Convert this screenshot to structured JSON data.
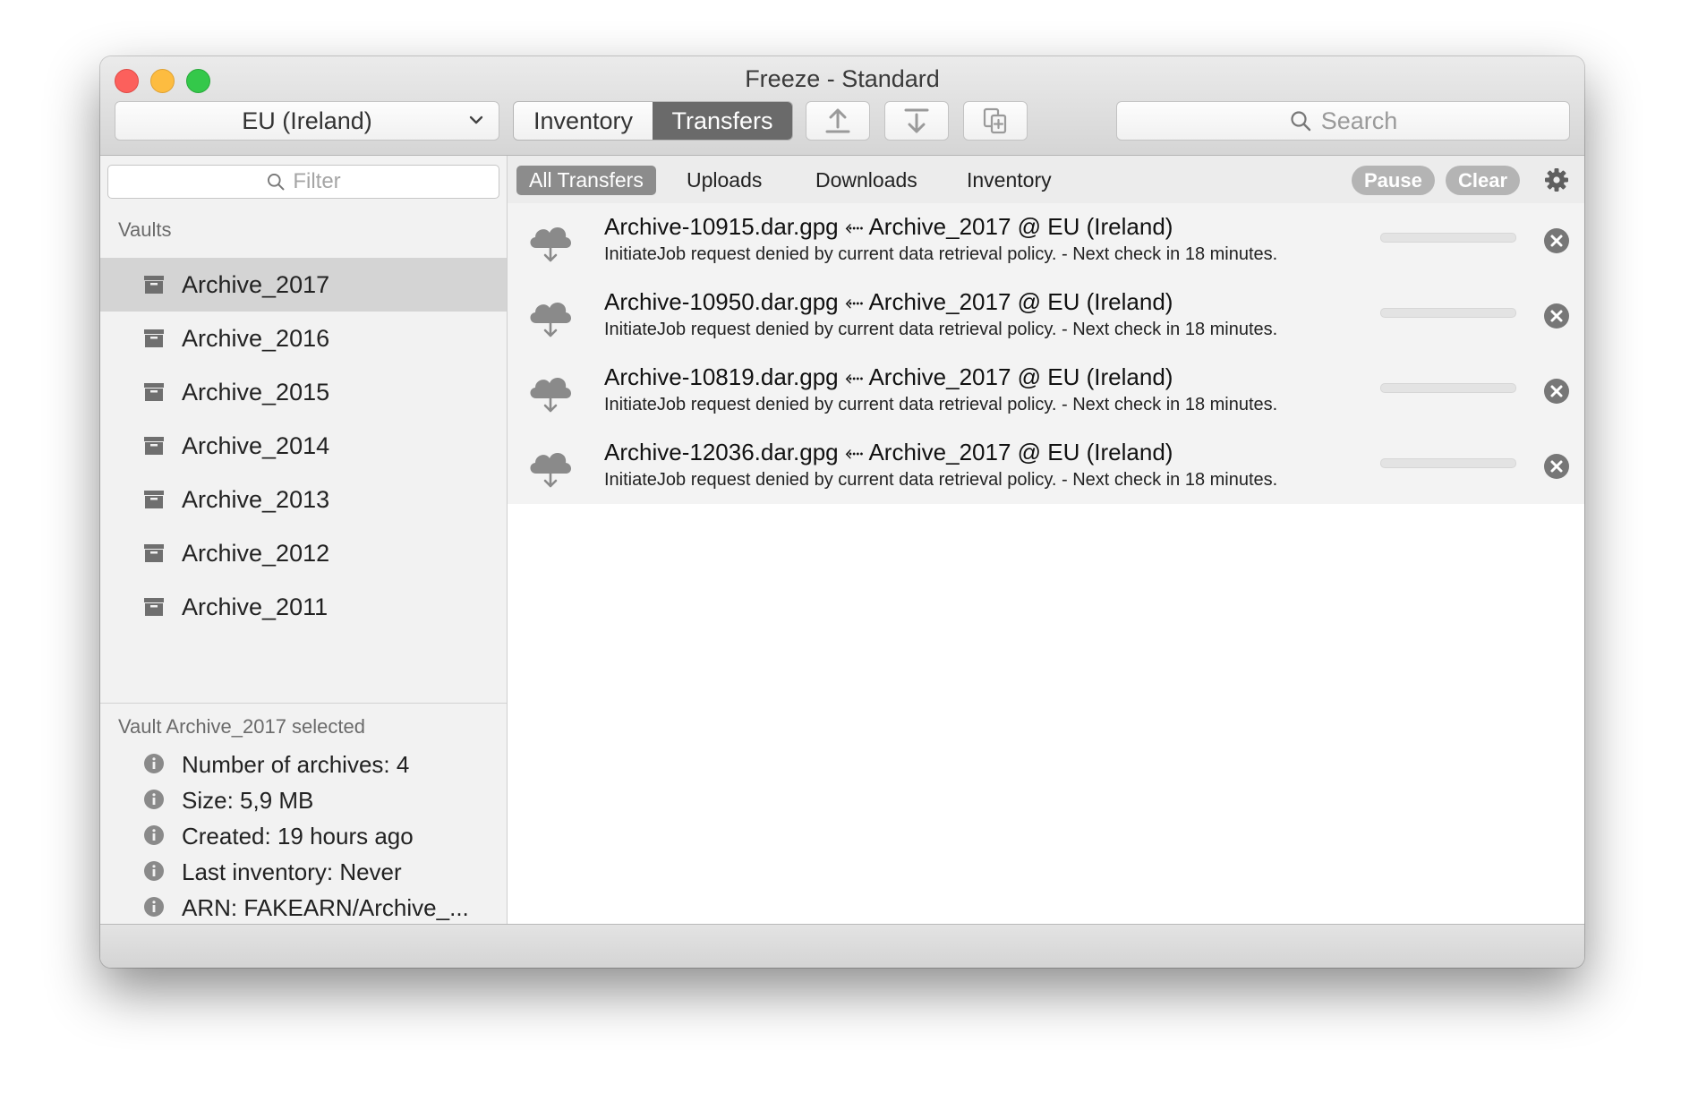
{
  "window": {
    "title": "Freeze - Standard"
  },
  "toolbar": {
    "region": "EU (Ireland)",
    "tab_inventory": "Inventory",
    "tab_transfers": "Transfers",
    "search_placeholder": "Search"
  },
  "sidebar": {
    "filter_placeholder": "Filter",
    "vaults_header": "Vaults",
    "vaults": [
      {
        "label": "Archive_2017"
      },
      {
        "label": "Archive_2016"
      },
      {
        "label": "Archive_2015"
      },
      {
        "label": "Archive_2014"
      },
      {
        "label": "Archive_2013"
      },
      {
        "label": "Archive_2012"
      },
      {
        "label": "Archive_2011"
      }
    ],
    "selected_header": "Vault Archive_2017 selected",
    "info": [
      {
        "label": "Number of archives: 4"
      },
      {
        "label": "Size: 5,9 MB"
      },
      {
        "label": "Created: 19 hours ago"
      },
      {
        "label": "Last inventory: Never"
      },
      {
        "label": "ARN: FAKEARN/Archive_..."
      }
    ]
  },
  "filterbar": {
    "tabs": [
      {
        "label": "All Transfers"
      },
      {
        "label": "Uploads"
      },
      {
        "label": "Downloads"
      },
      {
        "label": "Inventory"
      }
    ],
    "pause_label": "Pause",
    "clear_label": "Clear"
  },
  "transfers": [
    {
      "title": "Archive-10915.dar.gpg ⬸ Archive_2017 @ EU (Ireland)",
      "status": "InitiateJob request denied by current data retrieval policy. - Next check in 18 minutes.",
      "progress": 0
    },
    {
      "title": "Archive-10950.dar.gpg ⬸ Archive_2017 @ EU (Ireland)",
      "status": "InitiateJob request denied by current data retrieval policy. - Next check in 18 minutes.",
      "progress": 0
    },
    {
      "title": "Archive-10819.dar.gpg ⬸ Archive_2017 @ EU (Ireland)",
      "status": "InitiateJob request denied by current data retrieval policy. - Next check in 18 minutes.",
      "progress": 0
    },
    {
      "title": "Archive-12036.dar.gpg ⬸ Archive_2017 @ EU (Ireland)",
      "status": "InitiateJob request denied by current data retrieval policy. - Next check in 18 minutes.",
      "progress": 0
    }
  ],
  "icons": {
    "vault": "archive-box-icon",
    "info": "info-circle-icon",
    "transfer": "cloud-download-icon",
    "cancel": "close-circle-icon"
  }
}
